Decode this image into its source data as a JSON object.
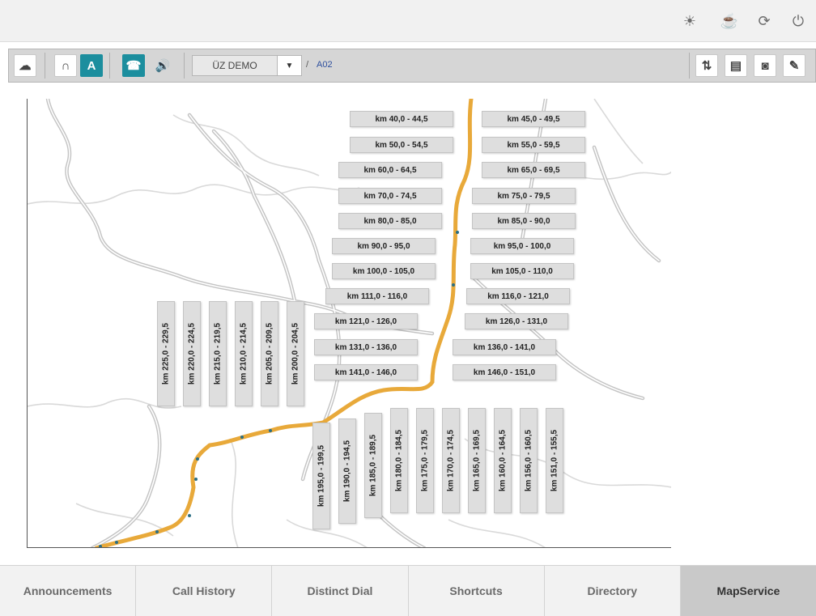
{
  "topbar": {
    "icons": [
      "brightness-icon",
      "coffee-icon",
      "refresh-icon",
      "power-icon"
    ]
  },
  "toolbar": {
    "left_icons": [
      "cloud-upload-icon",
      "tunnel-icon",
      "road-icon",
      "emergency-phone-icon",
      "speaker-radio-icon"
    ],
    "system_select": "ÜZ DEMO",
    "breadcrumb_sep": "/",
    "road": "A02",
    "right_icons": [
      "sync-icon",
      "calendar-icon",
      "speaker-icon",
      "pen-icon"
    ]
  },
  "map": {
    "route_color": "#e8a93a",
    "segments_horizontal": [
      "km 40,0 - 44,5",
      "km 45,0 - 49,5",
      "km 50,0 - 54,5",
      "km 55,0 - 59,5",
      "km 60,0 - 64,5",
      "km 65,0 - 69,5",
      "km 70,0 - 74,5",
      "km 75,0 - 79,5",
      "km 80,0 - 85,0",
      "km 85,0 - 90,0",
      "km 90,0 - 95,0",
      "km 95,0 - 100,0",
      "km 100,0 - 105,0",
      "km 105,0 - 110,0",
      "km 111,0 - 116,0",
      "km 116,0 - 121,0",
      "km 121,0 - 126,0",
      "km 126,0 - 131,0",
      "km 131,0 - 136,0",
      "km 136,0 - 141,0",
      "km 141,0 - 146,0",
      "km 146,0 - 151,0"
    ],
    "segments_vertical_west": [
      "km 225,0 - 229,5",
      "km 220,0 - 224,5",
      "km 215,0 - 219,5",
      "km 210,0 - 214,5",
      "km 205,0 - 209,5",
      "km 200,0 - 204,5"
    ],
    "segments_vertical_south": [
      "km 195,0 - 199,5",
      "km 190,0 - 194,5",
      "km 185,0 - 189,5",
      "km 180,0 - 184,5",
      "km 175,0 - 179,5",
      "km 170,0 - 174,5",
      "km 165,0 - 169,5",
      "km 160,0 - 164,5",
      "km 156,0 - 160,5",
      "km 151,0 - 155,5"
    ]
  },
  "tabs": [
    {
      "label": "Announcements",
      "active": false
    },
    {
      "label": "Call History",
      "active": false
    },
    {
      "label": "Distinct Dial",
      "active": false
    },
    {
      "label": "Shortcuts",
      "active": false
    },
    {
      "label": "Directory",
      "active": false
    },
    {
      "label": "MapService",
      "active": true
    }
  ]
}
